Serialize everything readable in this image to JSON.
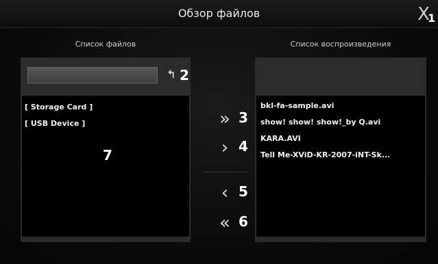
{
  "window": {
    "title": "Обзор файлов",
    "close_icon": "X",
    "close_callout": "1"
  },
  "file_pane": {
    "label": "Список файлов",
    "path_value": "",
    "up_icon": "↰",
    "up_callout": "2",
    "items": [
      "[ Storage Card ]",
      "[ USB Device ]"
    ],
    "list_callout": "7"
  },
  "transfer": {
    "add_all": {
      "icon": "»",
      "callout": "3"
    },
    "add_one": {
      "icon": "›",
      "callout": "4"
    },
    "remove_one": {
      "icon": "‹",
      "callout": "5"
    },
    "remove_all": {
      "icon": "«",
      "callout": "6"
    }
  },
  "playlist_pane": {
    "label": "Список воспроизведения",
    "items": [
      "bkl-fa-sample.avi",
      "show! show! show!_by Q.avi",
      "KARA.AVI",
      "Tell Me-XViD-KR-2007-iNT-Sk..."
    ]
  }
}
